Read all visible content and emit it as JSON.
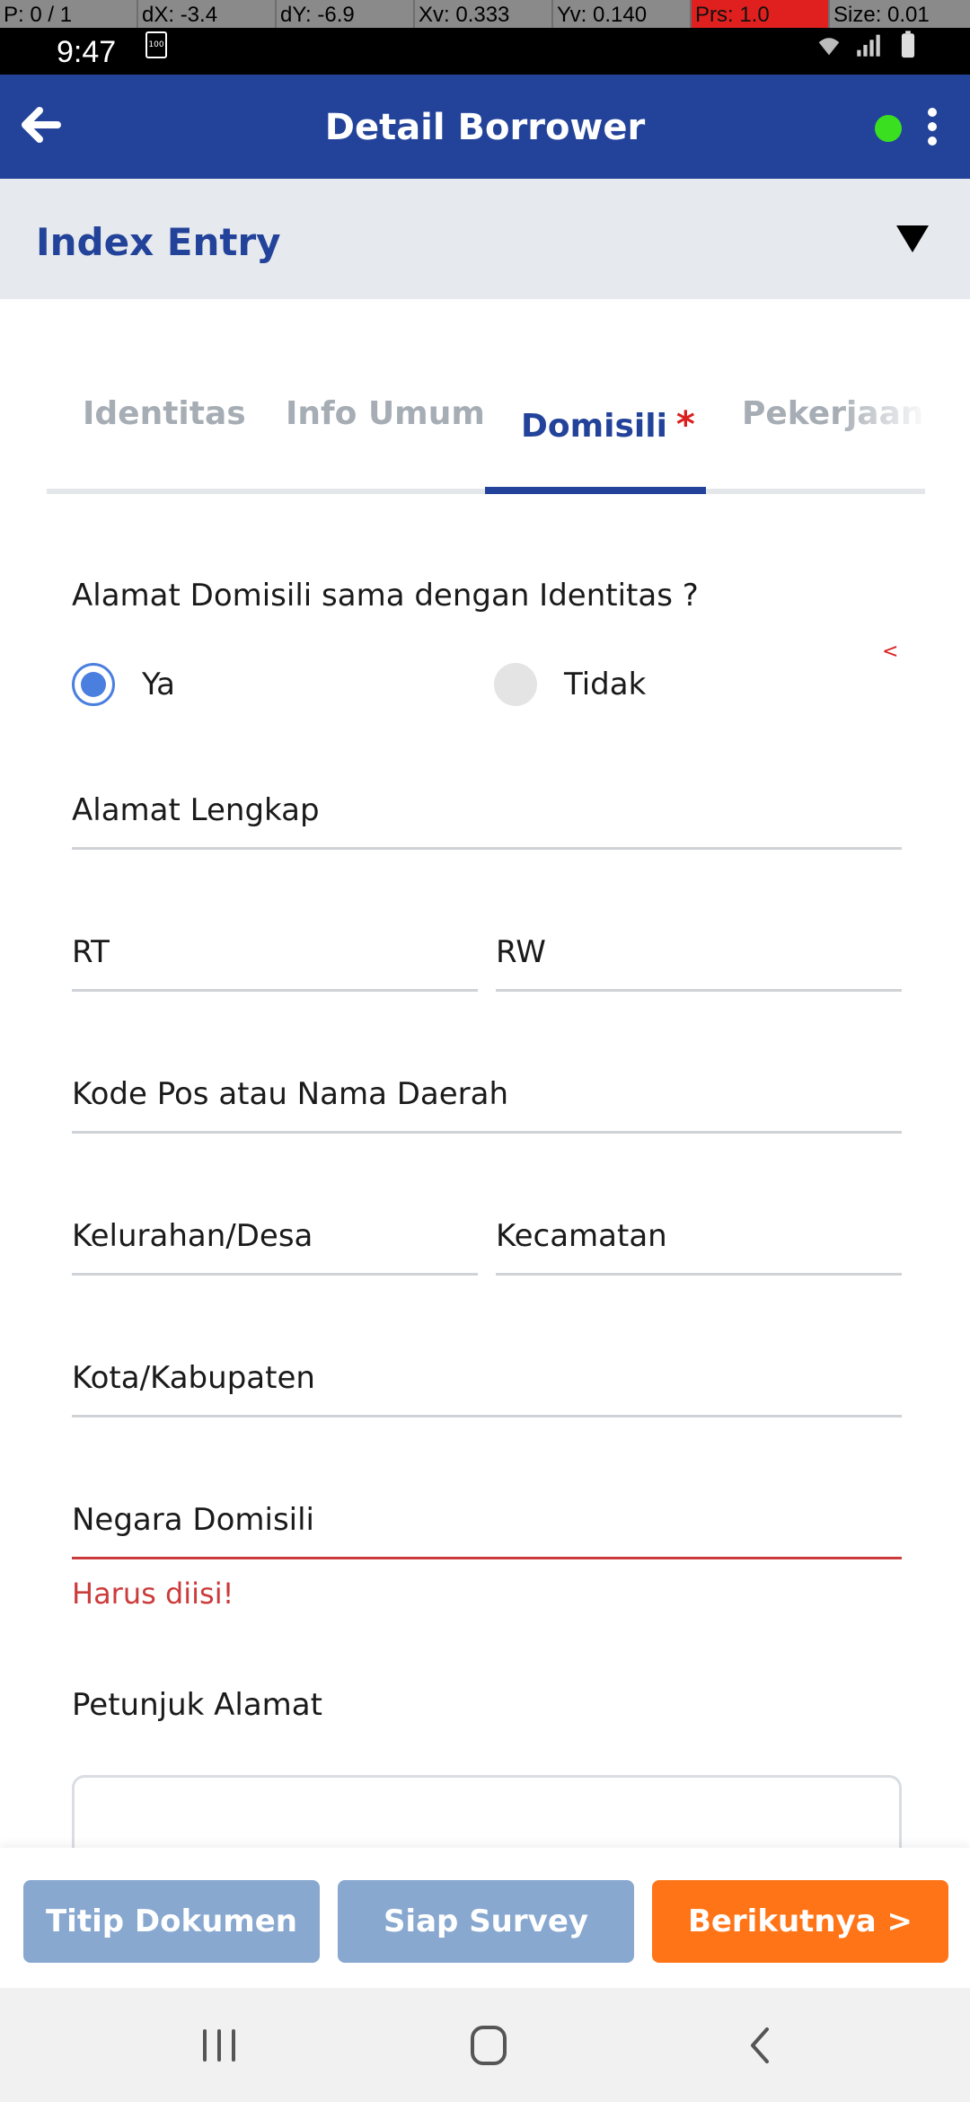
{
  "debug": {
    "pointer": "P: 0 / 1",
    "dx": "dX: -3.4",
    "dy": "dY: -6.9",
    "xv": "Xv: 0.333",
    "yv": "Yv: 0.140",
    "prs": "Prs: 1.0",
    "size": "Size: 0.01"
  },
  "status_bar": {
    "time": "9:47",
    "battery_badge": "100"
  },
  "header": {
    "title": "Detail Borrower",
    "status_dot_color": "#3ae01f",
    "bg_color": "#23439a"
  },
  "index_entry": {
    "title": "Index Entry"
  },
  "tabs": [
    {
      "label": "Identitas",
      "active": false
    },
    {
      "label": "Info Umum",
      "active": false
    },
    {
      "label": "Domisili",
      "active": true,
      "required_mark": "*"
    },
    {
      "label": "Pekerjaan",
      "active": false
    }
  ],
  "form": {
    "same_address_question": "Alamat Domisili sama dengan Identitas ?",
    "radio_yes": "Ya",
    "radio_no": "Tidak",
    "radio_selected": "Ya",
    "side_marker": "<",
    "alamat_lengkap": "Alamat Lengkap",
    "rt": "RT",
    "rw": "RW",
    "kode_pos": "Kode Pos atau Nama Daerah",
    "kelurahan": "Kelurahan/Desa",
    "kecamatan": "Kecamatan",
    "kota": "Kota/Kabupaten",
    "negara": "Negara Domisili",
    "negara_error": "Harus diisi!",
    "petunjuk": "Petunjuk Alamat"
  },
  "actions": {
    "titip": "Titip Dokumen",
    "siap": "Siap Survey",
    "next": "Berikutnya >"
  },
  "colors": {
    "primary": "#23439a",
    "accent_orange": "#ff7417",
    "disabled_blue": "#88a8d0",
    "error": "#cc3b3b"
  }
}
